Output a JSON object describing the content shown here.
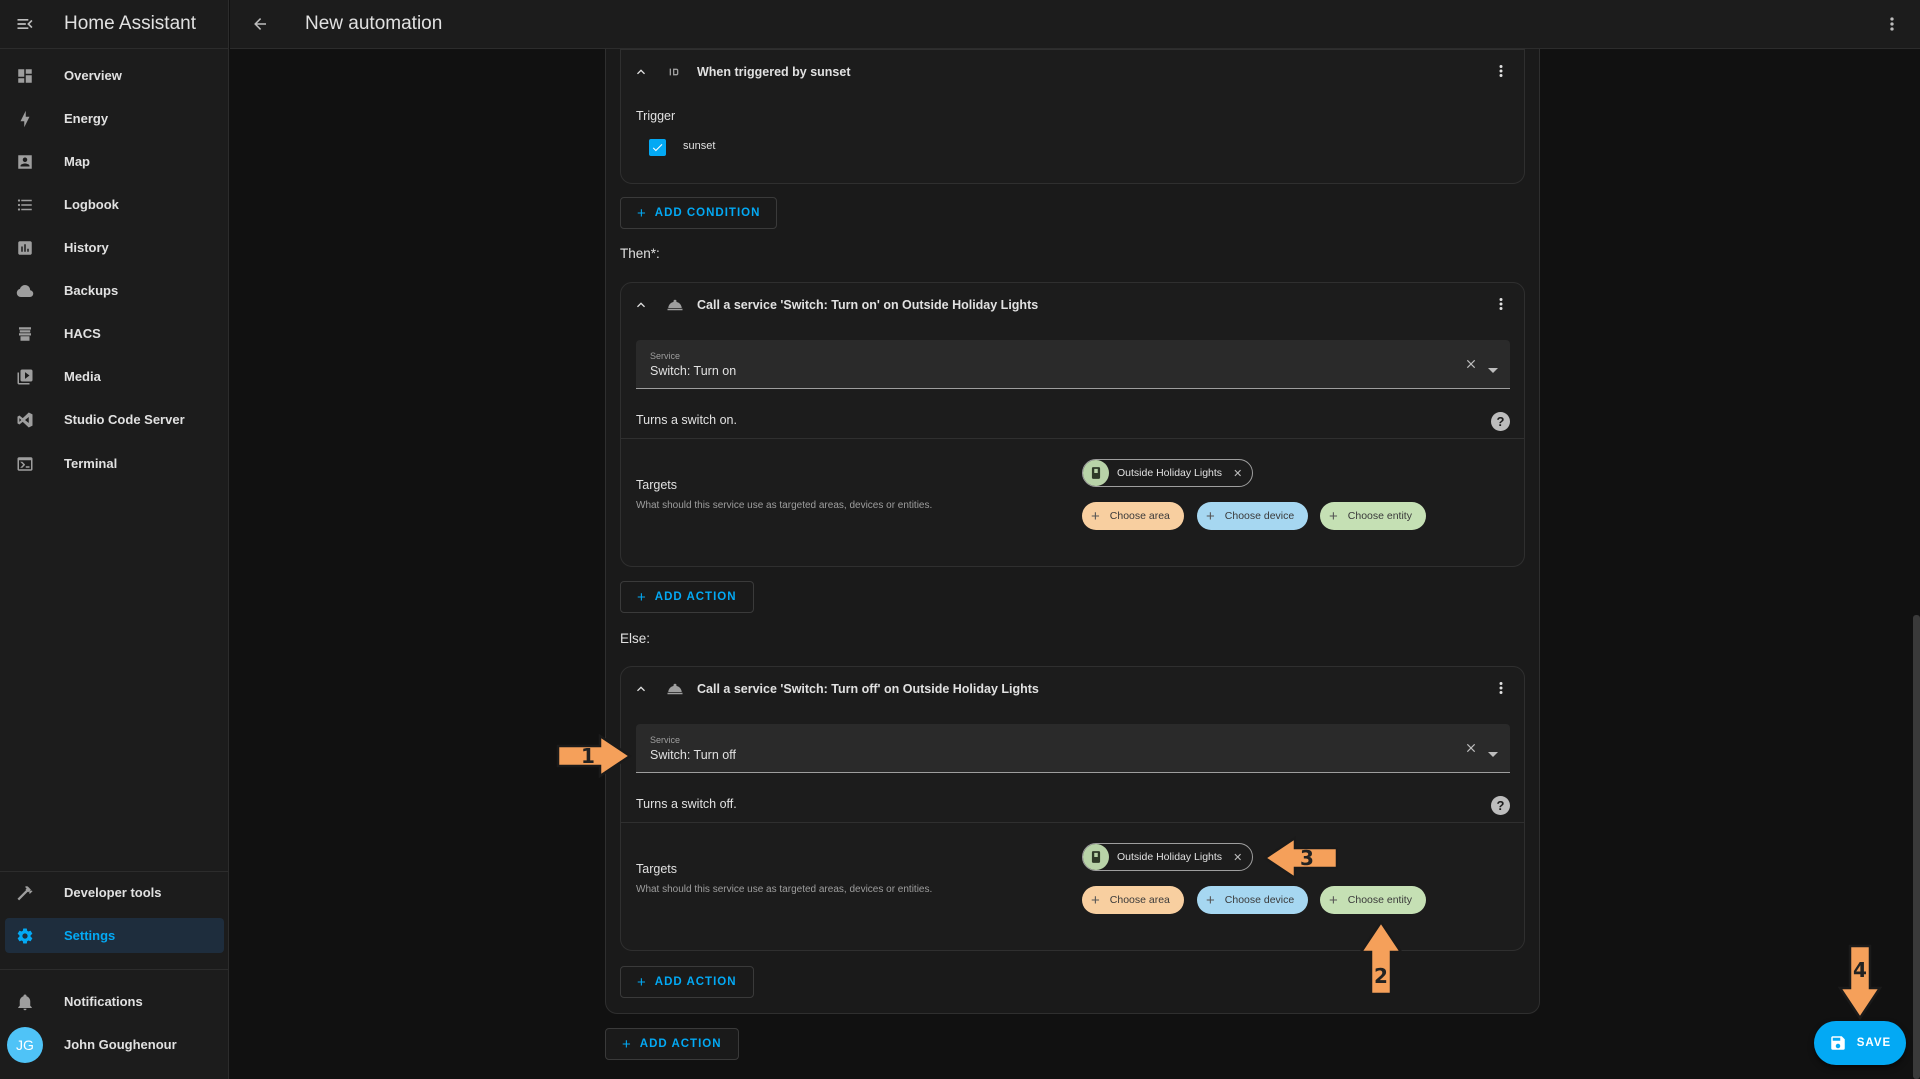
{
  "app": {
    "title": "Home Assistant"
  },
  "topbar": {
    "title": "New automation"
  },
  "sidebar": {
    "items": [
      {
        "label": "Overview",
        "icon": "dashboard-icon"
      },
      {
        "label": "Energy",
        "icon": "lightning-icon"
      },
      {
        "label": "Map",
        "icon": "map-account-icon"
      },
      {
        "label": "Logbook",
        "icon": "list-icon"
      },
      {
        "label": "History",
        "icon": "chart-box-icon"
      },
      {
        "label": "Backups",
        "icon": "cloud-icon"
      },
      {
        "label": "HACS",
        "icon": "hacs-icon"
      },
      {
        "label": "Media",
        "icon": "play-box-icon"
      },
      {
        "label": "Studio Code Server",
        "icon": "vscode-icon"
      },
      {
        "label": "Terminal",
        "icon": "console-icon"
      }
    ],
    "developer_tools": "Developer tools",
    "settings": "Settings",
    "notifications": "Notifications",
    "user": {
      "name": "John Goughenour",
      "initials": "JG"
    }
  },
  "condition_card": {
    "title": "When triggered by sunset",
    "trigger_label": "Trigger",
    "checkbox_label": "sunset",
    "checked": true
  },
  "add_condition": "ADD CONDITION",
  "then_label": "Then*:",
  "else_label": "Else:",
  "then_action": {
    "title": "Call a service 'Switch: Turn on' on Outside Holiday Lights",
    "service_label": "Service",
    "service_value": "Switch: Turn on",
    "description": "Turns a switch on.",
    "targets_title": "Targets",
    "targets_sub": "What should this service use as targeted areas, devices or entities.",
    "entity_chip": "Outside Holiday Lights",
    "choose_area": "Choose area",
    "choose_device": "Choose device",
    "choose_entity": "Choose entity"
  },
  "else_action": {
    "title": "Call a service 'Switch: Turn off' on Outside Holiday Lights",
    "service_label": "Service",
    "service_value": "Switch: Turn off",
    "description": "Turns a switch off.",
    "targets_title": "Targets",
    "targets_sub": "What should this service use as targeted areas, devices or entities.",
    "entity_chip": "Outside Holiday Lights",
    "choose_area": "Choose area",
    "choose_device": "Choose device",
    "choose_entity": "Choose entity"
  },
  "add_action": "ADD ACTION",
  "save": "SAVE",
  "annotations": {
    "one": "1",
    "two": "2",
    "three": "3",
    "four": "4"
  },
  "colors": {
    "accent": "#03a9f4",
    "arrow": "#f5a05a",
    "area": "#f8cfa0",
    "device": "#a6d7f1",
    "entity": "#c5e0b4"
  }
}
